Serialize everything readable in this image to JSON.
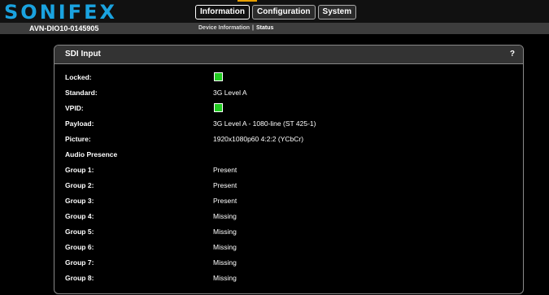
{
  "brand": {
    "logo": "SONIFEX"
  },
  "nav": {
    "tabs": [
      "Information",
      "Configuration",
      "System"
    ]
  },
  "subbar": {
    "device": "AVN-DIO10-0145905",
    "crumb1": "Device Information",
    "sep": "|",
    "crumb2": "Status"
  },
  "panel": {
    "title": "SDI Input",
    "help": "?",
    "rows": [
      {
        "label": "Locked:",
        "value": "",
        "indicator": "green"
      },
      {
        "label": "Standard:",
        "value": "3G Level A"
      },
      {
        "label": "VPID:",
        "value": "",
        "indicator": "green"
      },
      {
        "label": "Payload:",
        "value": "3G Level A - 1080-line (ST 425-1)"
      },
      {
        "label": "Picture:",
        "value": "1920x1080p60 4:2:2 (YCbCr)"
      },
      {
        "label": "Audio Presence",
        "value": ""
      },
      {
        "label": "Group 1:",
        "value": "Present"
      },
      {
        "label": "Group 2:",
        "value": "Present"
      },
      {
        "label": "Group 3:",
        "value": "Present"
      },
      {
        "label": "Group 4:",
        "value": "Missing"
      },
      {
        "label": "Group 5:",
        "value": "Missing"
      },
      {
        "label": "Group 6:",
        "value": "Missing"
      },
      {
        "label": "Group 7:",
        "value": "Missing"
      },
      {
        "label": "Group 8:",
        "value": "Missing"
      }
    ]
  },
  "colors": {
    "brand": "#1aa3e0",
    "led_ok": "#22cc22",
    "accent": "#e8a000"
  }
}
